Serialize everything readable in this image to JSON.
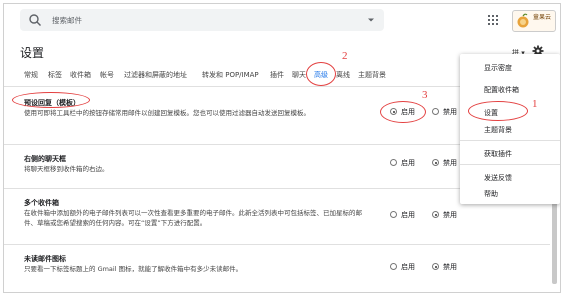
{
  "search": {
    "placeholder": "搜索邮件"
  },
  "brand": {
    "line1": "童果云",
    "line2": ""
  },
  "page": {
    "title": "设置",
    "lang": "拼"
  },
  "tabs": [
    "常规",
    "标签",
    "收件箱",
    "帐号",
    "过滤器和屏蔽的地址",
    "转发和 POP/IMAP",
    "插件",
    "聊天",
    "高级",
    "离线",
    "主题背景"
  ],
  "active_tab": "高级",
  "sections": [
    {
      "title": "预设回复（模板）",
      "desc": "使用可即将工具栏中的按钮存储常用邮件以创建回复模板。您也可以使用过滤器自动发送回复模板。",
      "on_label": "启用",
      "off_label": "禁用",
      "enabled": true
    },
    {
      "title": "右侧的聊天框",
      "desc": "将聊天框移到收件箱的右边。",
      "on_label": "启用",
      "off_label": "禁用",
      "enabled": false
    },
    {
      "title": "多个收件箱",
      "desc": "在收件箱中添加额外的电子邮件列表可以一次性查看更多重要的电子邮件。此新全活列表中可包括标签、已加星标的邮件、草稿或您希望搜索的任何内容。可在“设置”下方进行配置。",
      "on_label": "启用",
      "off_label": "禁用",
      "enabled": false
    },
    {
      "title": "未读邮件图标",
      "desc": "只要看一下标签标题上的 Gmail 图标，就能了解收件箱中有多少未读邮件。",
      "on_label": "启用",
      "off_label": "禁用",
      "enabled": false
    }
  ],
  "menu": {
    "items": [
      "显示密度",
      "配置收件箱",
      "设置",
      "主题背景",
      "获取插件",
      "发送反馈",
      "帮助"
    ]
  },
  "annotations": [
    "1",
    "2",
    "3"
  ],
  "colors": {
    "annotation": "#e34040",
    "active_tab": "#1a73e8"
  }
}
